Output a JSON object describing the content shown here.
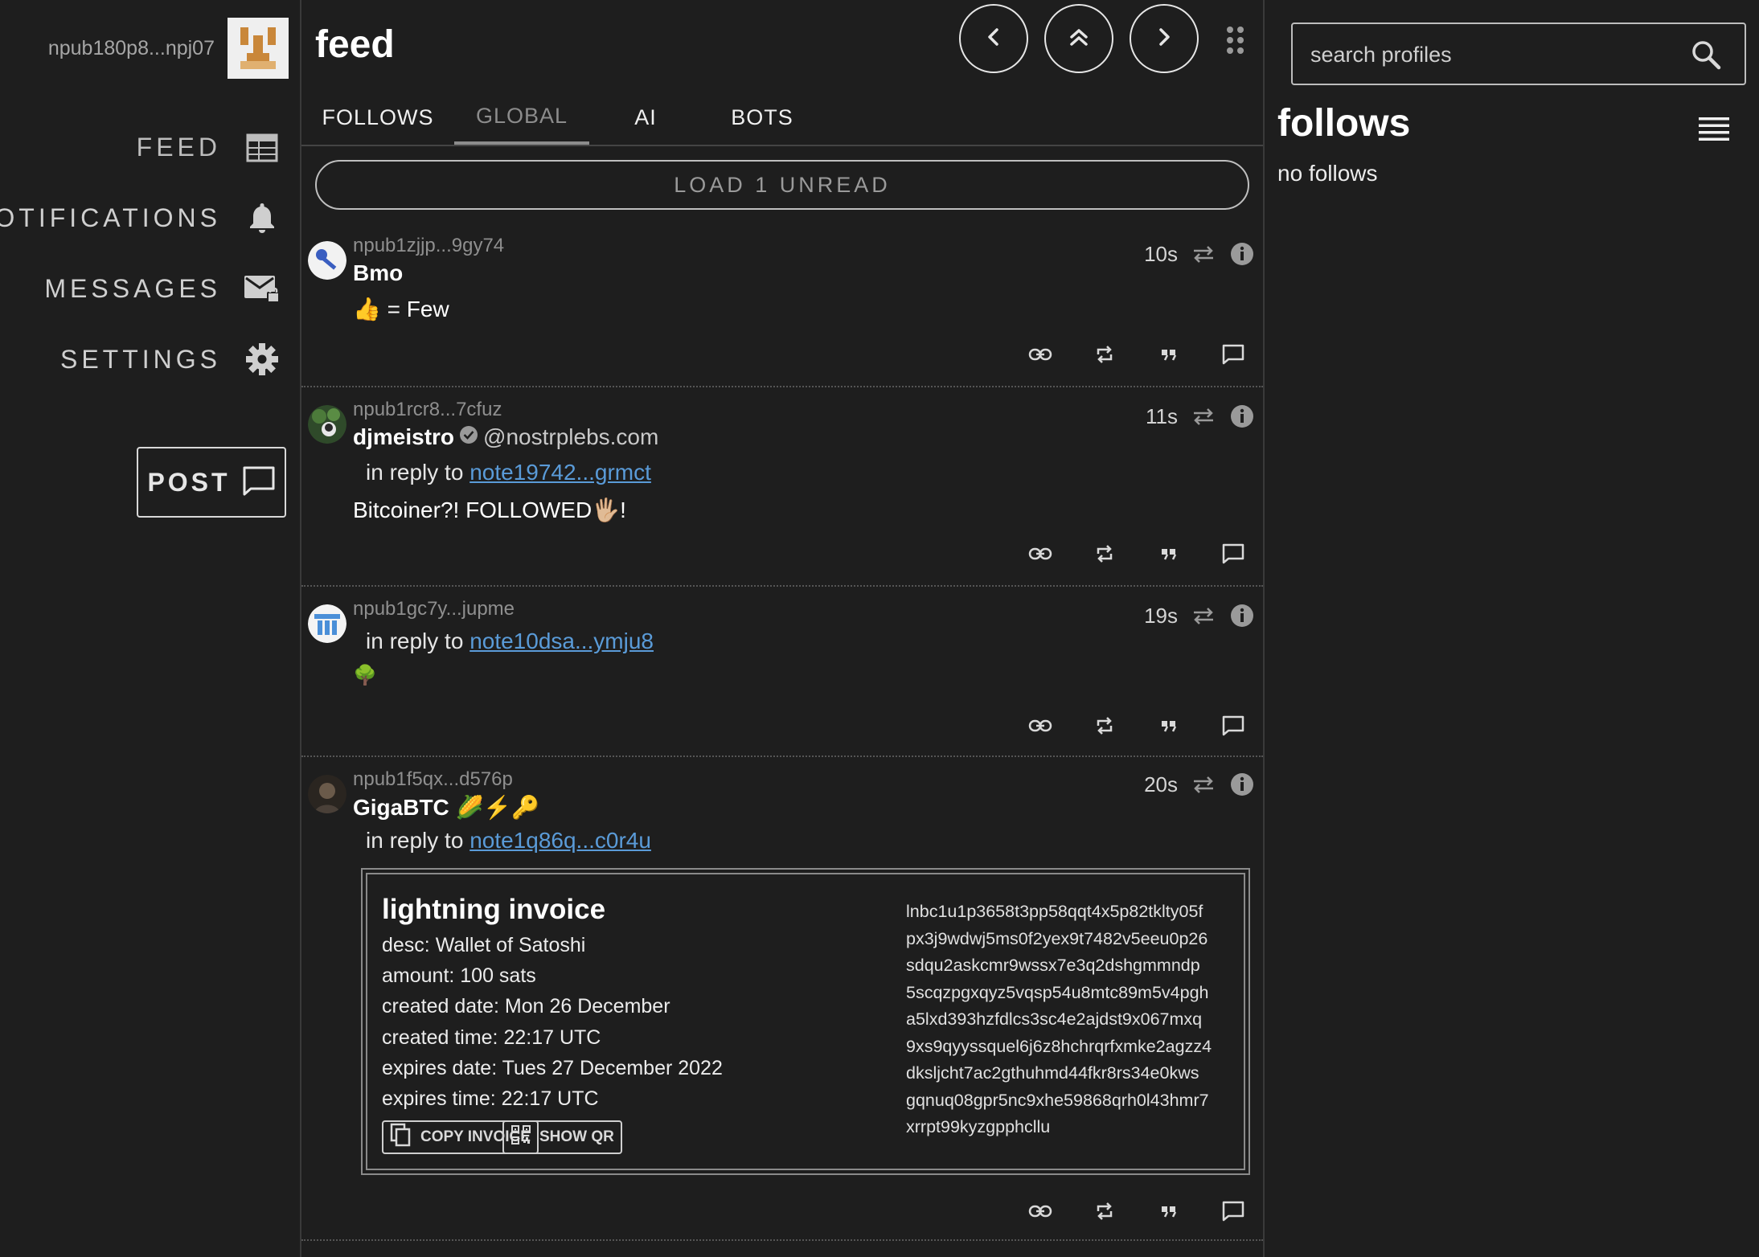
{
  "account": {
    "npub": "npub180p8...npj07"
  },
  "nav": {
    "feed": "FEED",
    "notifications": "NOTIFICATIONS",
    "messages": "MESSAGES",
    "settings": "SETTINGS",
    "post": "POST"
  },
  "header": {
    "title": "feed"
  },
  "tabs": [
    {
      "label": "FOLLOWS",
      "active": false
    },
    {
      "label": "GLOBAL",
      "active": true
    },
    {
      "label": "AI",
      "active": false
    },
    {
      "label": "BOTS",
      "active": false
    }
  ],
  "load_unread": "LOAD 1 UNREAD",
  "posts": [
    {
      "npub": "npub1zjjp...9gy74",
      "name": "Bmo",
      "age": "10s",
      "content": "👍 = Few"
    },
    {
      "npub": "npub1rcr8...7cfuz",
      "name": "djmeistro",
      "nip05": "@nostrplebs.com",
      "age": "11s",
      "reply_prefix": "in reply to",
      "reply_to": "note19742...grmct",
      "content": "Bitcoiner?! FOLLOWED🖐🏼!"
    },
    {
      "npub": "npub1gc7y...jupme",
      "age": "19s",
      "reply_prefix": "in reply to",
      "reply_to": "note10dsa...ymju8",
      "content": "🌳"
    },
    {
      "npub": "npub1f5qx...d576p",
      "name": "GigaBTC 🌽⚡🔑",
      "age": "20s",
      "reply_prefix": "in reply to",
      "reply_to": "note1q86q...c0r4u"
    }
  ],
  "invoice": {
    "title": "lightning invoice",
    "desc": "desc: Wallet of Satoshi",
    "amount": "amount: 100 sats",
    "created_date": "created date: Mon 26 December",
    "created_time": "created time: 22:17 UTC",
    "expires_date": "expires date: Tues 27 December 2022",
    "expires_time": "expires time: 22:17 UTC",
    "bolt11": "lnbc1u1p3658t3pp58qqt4x5p82tklty05f\npx3j9wdwj5ms0f2yex9t7482v5eeu0p26\nsdqu2askcmr9wssx7e3q2dshgmmndp\n5scqzpgxqyz5vqsp54u8mtc89m5v4pgh\na5lxd393hzfdlcs3sc4e2ajdst9x067mxq\n9xs9qyyssquel6j6z8hchrqrfxmke2agzz4\ndksljcht7ac2gthuhmd44fkr8rs34e0kws\ngqnuq08gpr5nc9xhe59868qrh0l43hmr7\nxrrpt99kyzgpphcllu",
    "copy_label": "COPY INVOICE",
    "qr_label": "SHOW QR"
  },
  "right": {
    "search_placeholder": "search profiles",
    "follows_title": "follows",
    "follows_empty": "no follows"
  }
}
